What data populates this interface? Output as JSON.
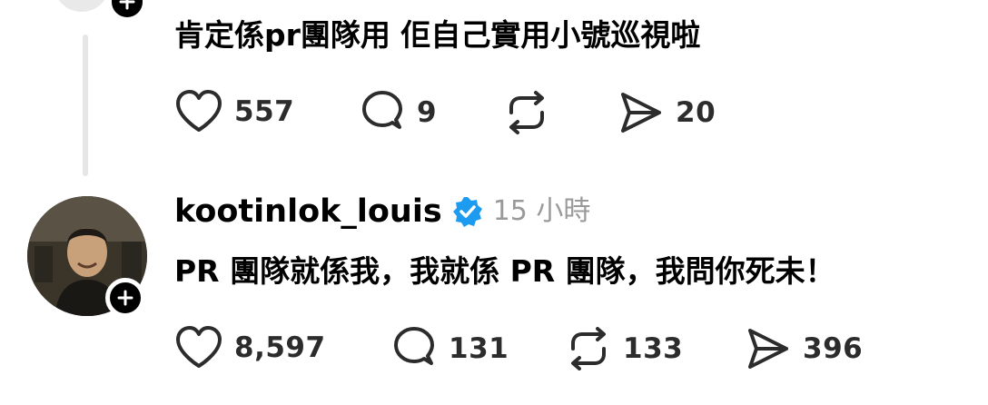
{
  "post1": {
    "text": "肯定係pr團隊用 佢自己實用小號巡視啦",
    "actions": {
      "likes": "557",
      "replies": "9",
      "reposts": "",
      "shares": "20"
    }
  },
  "post2": {
    "username": "kootinlok_louis",
    "timestamp": "15 小時",
    "verified": true,
    "text": "PR 團隊就係我，我就係 PR 團隊，我問你死未！",
    "actions": {
      "likes": "8,597",
      "replies": "131",
      "reposts": "133",
      "shares": "396"
    }
  },
  "icons": {
    "like": "heart-icon",
    "reply": "comment-icon",
    "repost": "repost-icon",
    "share": "send-icon",
    "follow": "plus-icon",
    "verified": "verified-badge-icon"
  },
  "colors": {
    "verified": "#1d9bf0",
    "muted": "#9a9a9a",
    "thread_line": "#e6e6e6"
  }
}
